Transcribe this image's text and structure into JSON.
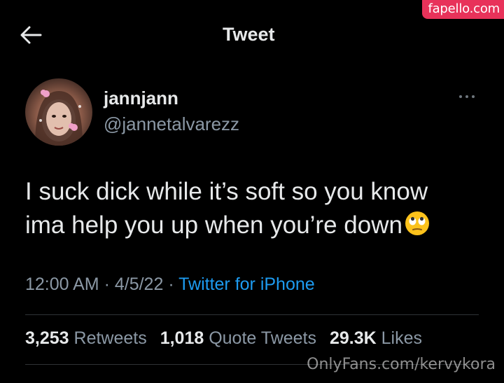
{
  "watermark": {
    "top": "fapello.com",
    "bottom": "OnlyFans.com/kervykora"
  },
  "header": {
    "back_icon": "arrow-left-icon",
    "title": "Tweet"
  },
  "author": {
    "display_name": "jannjann",
    "handle": "@jannetalvarezz",
    "more_icon": "more-horizontal-icon"
  },
  "tweet": {
    "line1": "I suck dick while it’s soft so you know",
    "line2": "ima help you up when you’re down",
    "emoji": "face-with-rolling-eyes"
  },
  "meta": {
    "time": "12:00 AM",
    "sep1": " · ",
    "date": "4/5/22",
    "sep2": " · ",
    "source": "Twitter for iPhone"
  },
  "stats": {
    "retweets_count": "3,253",
    "retweets_label": "Retweets",
    "quotes_count": "1,018",
    "quotes_label": "Quote Tweets",
    "likes_count": "29.3K",
    "likes_label": "Likes"
  },
  "colors": {
    "background": "#000000",
    "primary_text": "#e7e9ea",
    "secondary_text": "#8b98a5",
    "link": "#1d9bf0",
    "divider": "#2f3336",
    "watermark_badge": "#e8325a"
  }
}
